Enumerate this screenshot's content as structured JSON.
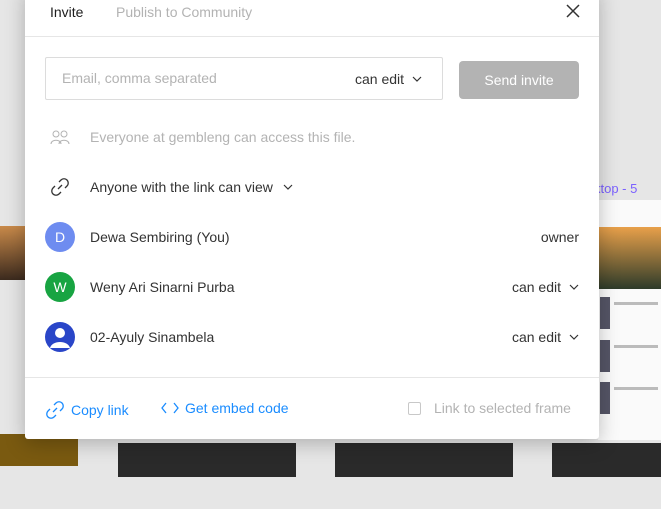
{
  "canvas": {
    "frame_label": "ktop - 5"
  },
  "tabs": [
    {
      "label": "Invite"
    },
    {
      "label": "Publish to Community"
    }
  ],
  "invite": {
    "email_placeholder": "Email, comma separated",
    "permission": "can edit",
    "send_label": "Send invite"
  },
  "access": {
    "team_text": "Everyone at gembleng can access this file.",
    "link_text": "Anyone with the link can view"
  },
  "people": [
    {
      "initial": "D",
      "name": "Dewa Sembiring (You)",
      "role": "owner",
      "color": "#6e8cf0"
    },
    {
      "initial": "W",
      "name": "Weny Ari Sinarni Purba",
      "role": "can edit",
      "color": "#18a442"
    },
    {
      "initial": "",
      "name": "02-Ayuly Sinambela",
      "role": "can edit",
      "color": "#2a46c8"
    }
  ],
  "footer": {
    "copy_link": "Copy link",
    "embed": "Get embed code",
    "selected_frame": "Link to selected frame"
  },
  "colors": {
    "accent": "#1a8cff",
    "muted": "#b3b3b3",
    "send_disabled": "#b3b3b3"
  }
}
